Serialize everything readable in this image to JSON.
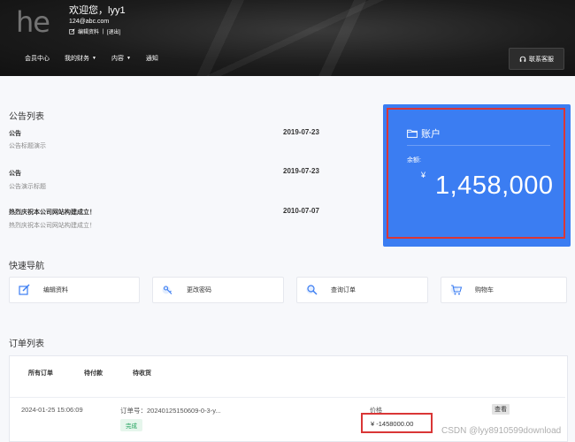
{
  "header": {
    "logo_text": "he",
    "welcome": "欢迎您，lyy1",
    "email": "124@abc.com",
    "edit_profile": "编辑资料",
    "separator": "|",
    "logout": "[退出]",
    "nav": [
      {
        "label": "会员中心",
        "has_caret": false
      },
      {
        "label": "我的财务",
        "has_caret": true
      },
      {
        "label": "内容",
        "has_caret": true
      },
      {
        "label": "通知",
        "has_caret": false
      }
    ],
    "service_button": "联系客服"
  },
  "announcements": {
    "title": "公告列表",
    "items": [
      {
        "title": "公告",
        "subtitle": "公告标题演示",
        "date": "2019-07-23"
      },
      {
        "title": "公告",
        "subtitle": "公告演示标题",
        "date": "2019-07-23"
      },
      {
        "title": "热烈庆祝本公司网站构建成立！",
        "subtitle": "热烈庆祝本公司网站构建成立！",
        "date": "2010-07-07"
      }
    ]
  },
  "account": {
    "title": "账户",
    "balance_label": "余额:",
    "currency": "¥",
    "balance": "1,458,000",
    "card_color": "#3b7df2"
  },
  "quick_nav": {
    "title": "快速导航",
    "items": [
      {
        "label": "编辑资料",
        "icon": "edit-icon"
      },
      {
        "label": "更改密码",
        "icon": "key-icon"
      },
      {
        "label": "查询订单",
        "icon": "search-icon"
      },
      {
        "label": "购物车",
        "icon": "cart-icon"
      }
    ]
  },
  "orders": {
    "title": "订单列表",
    "tabs": [
      "所有订单",
      "待付款",
      "待收货"
    ],
    "rows": [
      {
        "date": "2024-01-25 15:06:09",
        "order_no": "订单号：20240125150609-0-3-y...",
        "status": "完成",
        "price_label": "价格",
        "price": "¥ -1458000.00",
        "action": "查看"
      }
    ]
  },
  "watermark": "CSDN @lyy8910599download"
}
